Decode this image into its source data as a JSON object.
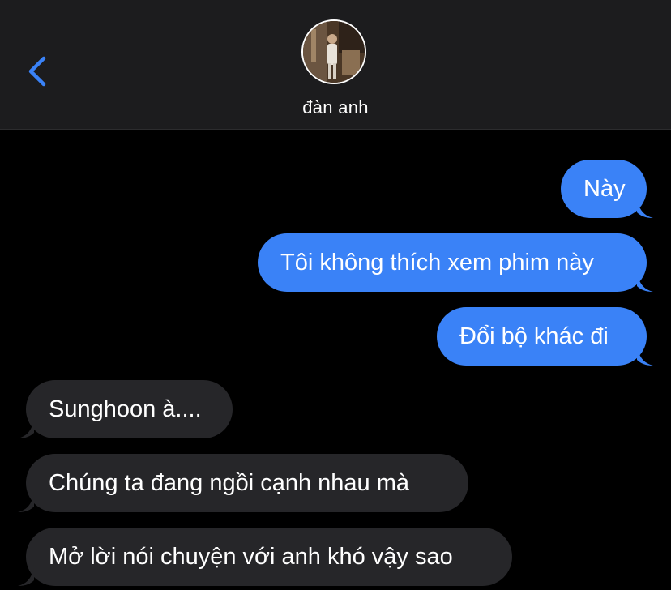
{
  "header": {
    "back_icon": "chevron-left-icon",
    "contact_name": "đàn anh",
    "accent_color": "#3a82f7"
  },
  "messages": [
    {
      "direction": "sent",
      "text": "Này"
    },
    {
      "direction": "sent",
      "text": "Tôi không thích xem phim này"
    },
    {
      "direction": "sent",
      "text": "Đổi bộ khác đi"
    },
    {
      "direction": "received",
      "text": "Sunghoon à...."
    },
    {
      "direction": "received",
      "text": "Chúng ta đang ngồi cạnh nhau mà"
    },
    {
      "direction": "received",
      "text": "Mở lời nói chuyện với anh khó vậy sao"
    }
  ],
  "colors": {
    "sent_bubble": "#3a82f7",
    "received_bubble": "#262629",
    "header_bg": "#1c1c1e",
    "background": "#000000"
  }
}
